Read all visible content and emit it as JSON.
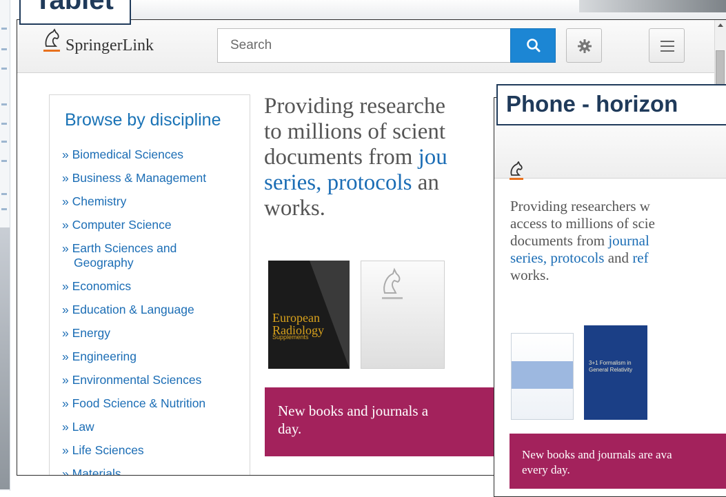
{
  "labels": {
    "tablet": "Tablet",
    "phone": "Phone - horizon"
  },
  "header": {
    "logo_springer": "Springer",
    "logo_link": "Link",
    "search_placeholder": "Search"
  },
  "sidebar": {
    "title": "Browse by discipline",
    "items": [
      {
        "label": "» Biomedical Sciences"
      },
      {
        "label": "» Business & Management"
      },
      {
        "label": "» Chemistry"
      },
      {
        "label": "» Computer Science"
      },
      {
        "label": "» Earth Sciences and",
        "cont": "Geography"
      },
      {
        "label": "» Economics"
      },
      {
        "label": "» Education & Language"
      },
      {
        "label": "» Energy"
      },
      {
        "label": "» Engineering"
      },
      {
        "label": "» Environmental Sciences"
      },
      {
        "label": "» Food Science & Nutrition"
      },
      {
        "label": "» Law"
      },
      {
        "label": "» Life Sciences"
      },
      {
        "label": "» Materials"
      }
    ]
  },
  "hero": {
    "l1": "Providing researche",
    "l2": "to millions of scient",
    "l3a": "documents from ",
    "l3b": "jou",
    "l4a": "series, protocols",
    "l4b": " an",
    "l5": "works."
  },
  "covers": {
    "c1_title1": "European",
    "c1_title2": "Radiology",
    "c1_sub": "Supplements"
  },
  "banner": {
    "l1": "New books and journals a",
    "l2": "day."
  },
  "phone": {
    "l1": "Providing researchers w",
    "l2": "access to millions of scie",
    "l3a": "documents from ",
    "l3b": "journal",
    "l4a": "series, protocols",
    "l4b": " and ",
    "l4c": "ref",
    "l5": "works.",
    "cover2_text": "3+1 Formalism in General Relativity",
    "banner_l1": "New books and journals are ava",
    "banner_l2": "every day."
  },
  "colors": {
    "accent_blue": "#1c86d4",
    "link_blue": "#1b6db5",
    "banner": "#a3225c",
    "label_navy": "#1f3a5a"
  }
}
